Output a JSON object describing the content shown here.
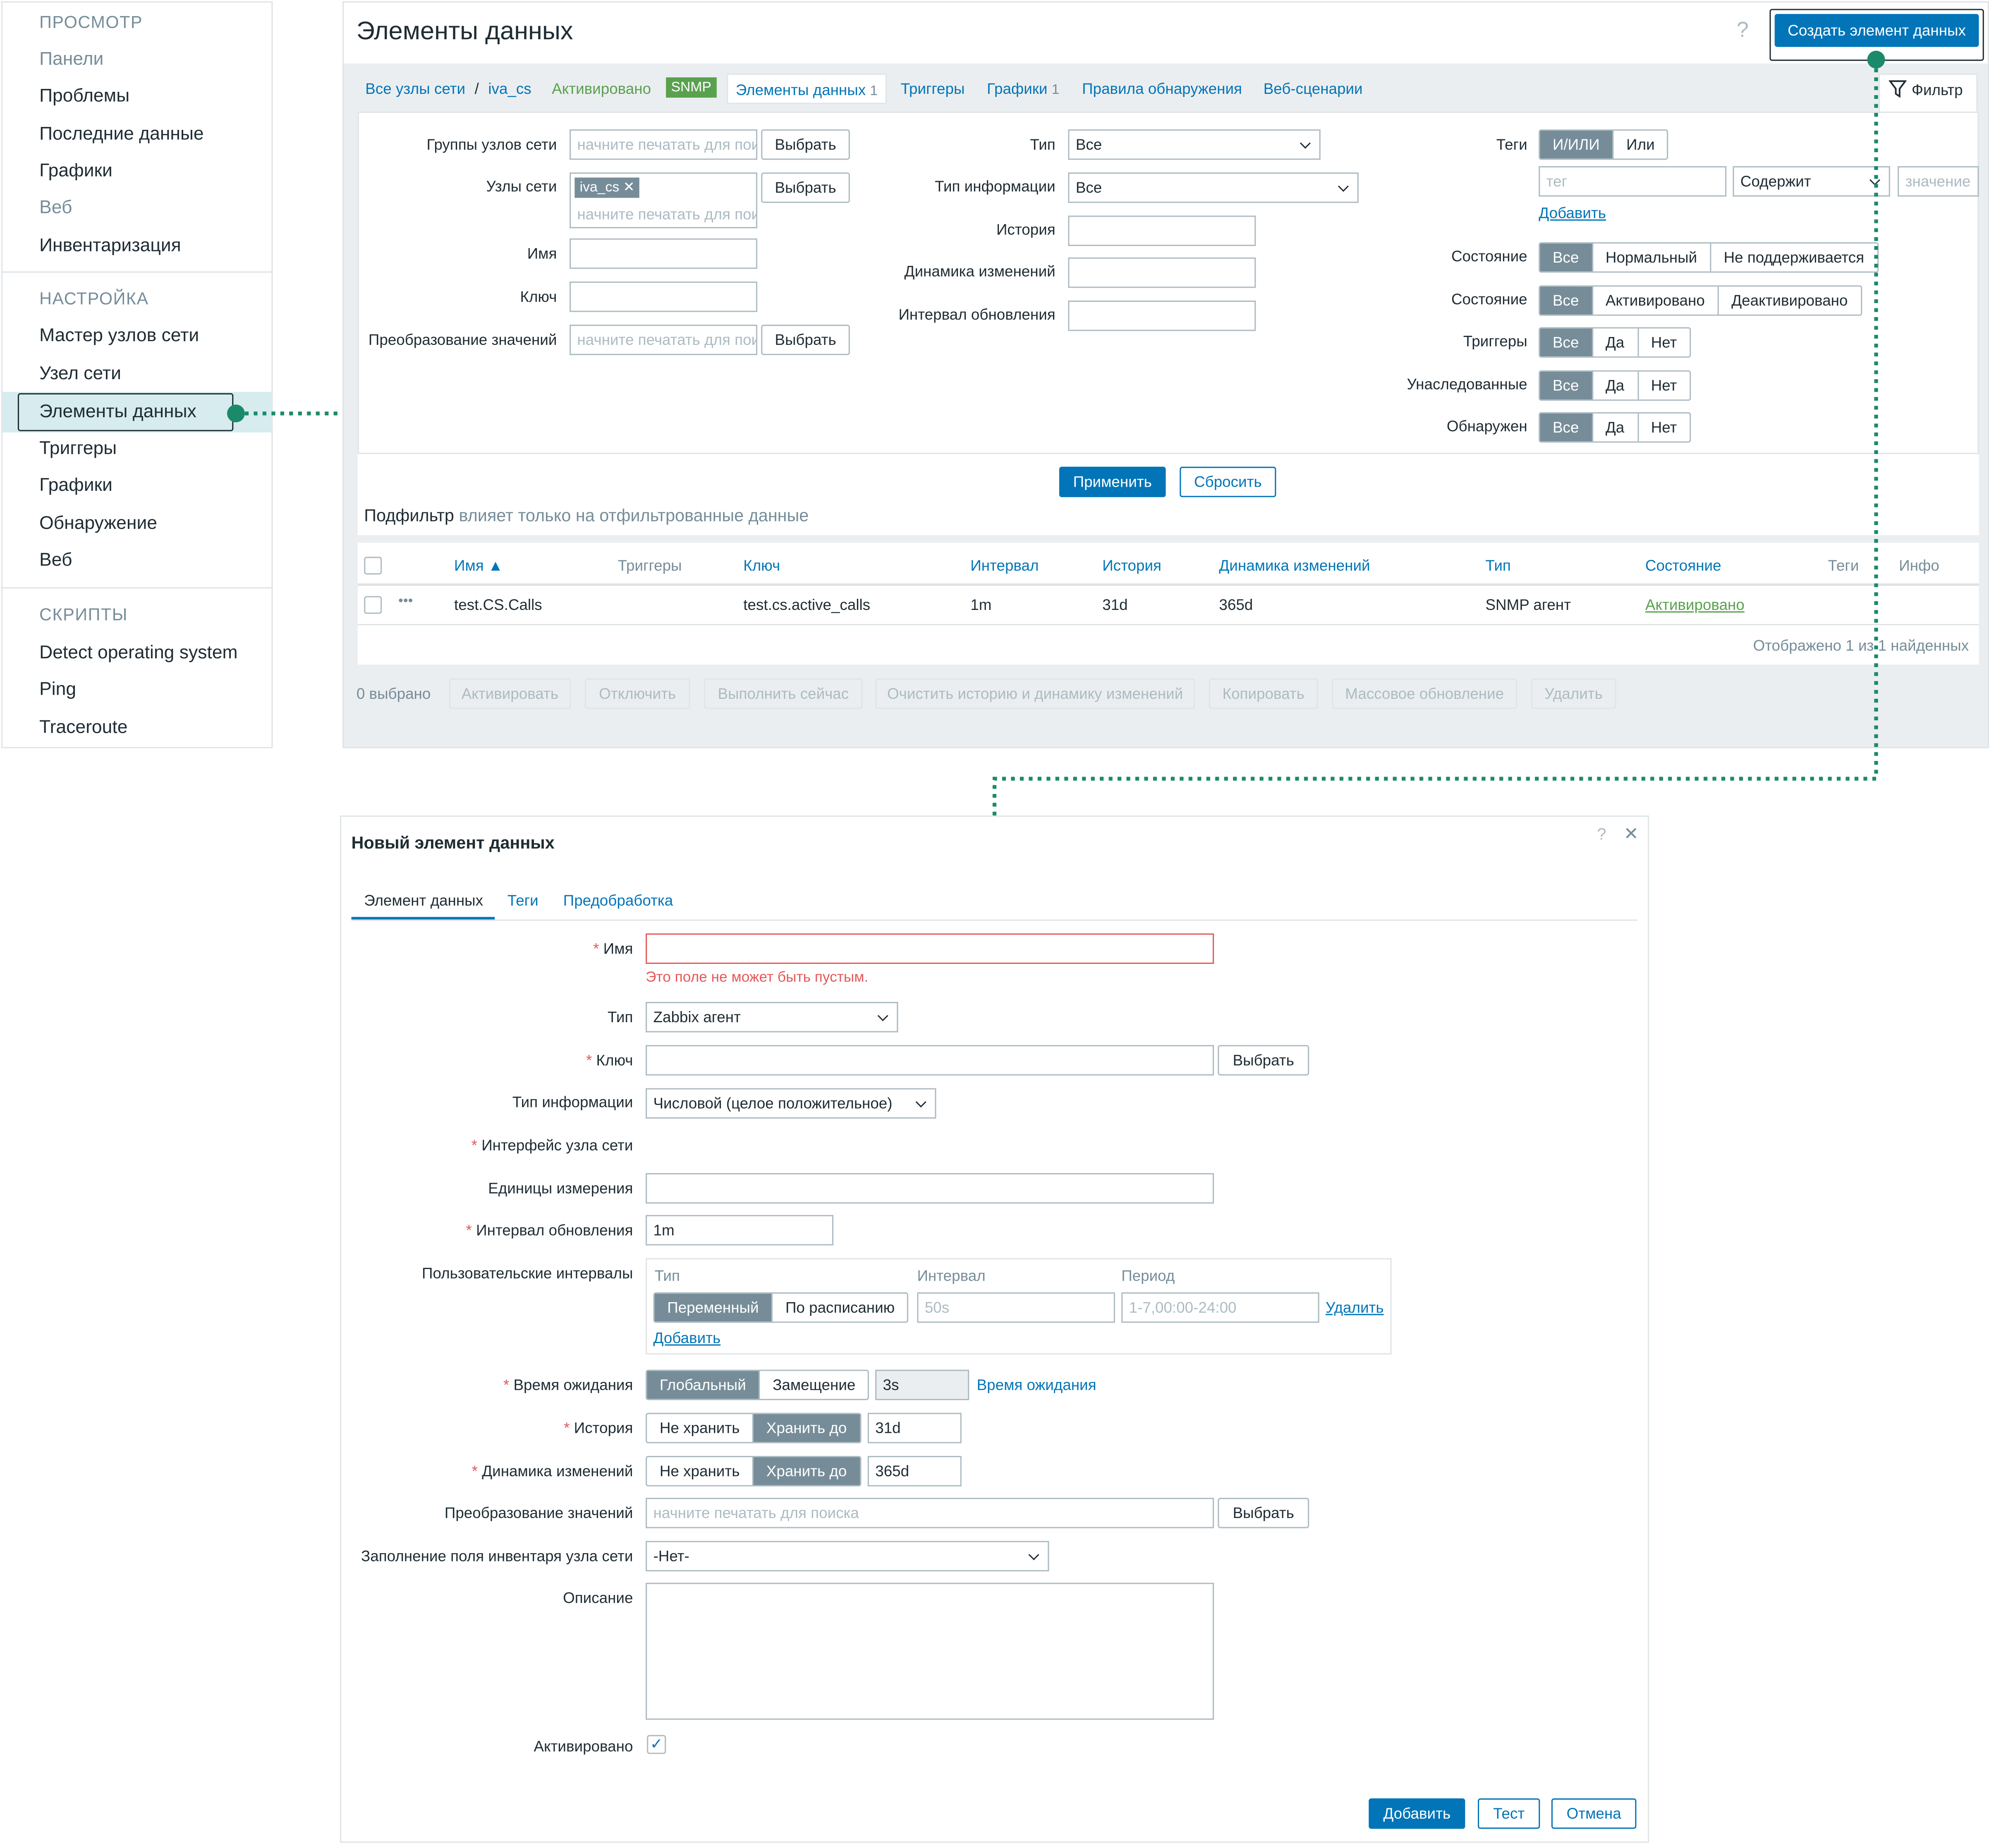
{
  "sidebar": {
    "view_header": "ПРОСМОТР",
    "view_items": [
      "Панели",
      "Проблемы",
      "Последние данные",
      "Графики",
      "Веб",
      "Инвентаризация"
    ],
    "config_header": "НАСТРОЙКА",
    "config_items": [
      "Мастер узлов сети",
      "Узел сети",
      "Элементы данных",
      "Триггеры",
      "Графики",
      "Обнаружение",
      "Веб"
    ],
    "scripts_header": "СКРИПТЫ",
    "scripts_items": [
      "Detect operating system",
      "Ping",
      "Traceroute"
    ]
  },
  "main": {
    "title": "Элементы данных",
    "help": "?",
    "create_button": "Создать элемент данных",
    "breadcrumb": {
      "all_hosts": "Все узлы сети",
      "sep": "/",
      "host": "iva_cs",
      "enabled": "Активировано",
      "snmp": "SNMP",
      "items": "Элементы данных",
      "items_count": "1",
      "triggers": "Триггеры",
      "graphs": "Графики",
      "graphs_count": "1",
      "discovery": "Правила обнаружения",
      "web": "Веб-сценарии"
    },
    "filter_tab": "Фильтр",
    "filter": {
      "host_groups_label": "Группы узлов сети",
      "host_groups_placeholder": "начните печатать для поиска",
      "hosts_label": "Узлы сети",
      "host_chip": "iva_cs",
      "hosts_placeholder": "начните печатать для поиска",
      "select": "Выбрать",
      "name_label": "Имя",
      "key_label": "Ключ",
      "valuemap_label": "Преобразование значений",
      "valuemap_placeholder": "начните печатать для поиска",
      "type_label": "Тип",
      "type_value": "Все",
      "info_type_label": "Тип информации",
      "info_type_value": "Все",
      "history_label": "История",
      "trends_label": "Динамика изменений",
      "interval_label": "Интервал обновления",
      "tags_label": "Теги",
      "tags_andor": "И/ИЛИ",
      "tags_or": "Или",
      "tag_placeholder": "тег",
      "tag_op": "Содержит",
      "value_placeholder": "значение",
      "add": "Добавить",
      "state_label": "Состояние",
      "state_opts": [
        "Все",
        "Нормальный",
        "Не поддерживается"
      ],
      "status_label": "Состояние",
      "status_opts": [
        "Все",
        "Активировано",
        "Деактивировано"
      ],
      "triggers_label": "Триггеры",
      "inherited_label": "Унаследованные",
      "discovered_label": "Обнаружен",
      "yn_opts": [
        "Все",
        "Да",
        "Нет"
      ],
      "apply": "Применить",
      "reset": "Сбросить"
    },
    "subfilter": "Подфильтр",
    "subfilter_note": "влияет только на отфильтрованные данные",
    "table": {
      "headers": [
        "Имя ▲",
        "Триггеры",
        "Ключ",
        "Интервал",
        "История",
        "Динамика изменений",
        "Тип",
        "Состояние",
        "Теги",
        "Инфо"
      ],
      "row": {
        "dots": "•••",
        "name": "test.CS.Calls",
        "key": "test.cs.active_calls",
        "interval": "1m",
        "history": "31d",
        "trends": "365d",
        "type": "SNMP агент",
        "status": "Активировано"
      },
      "footer": "Отображено 1 из 1 найденных"
    },
    "actions": {
      "selected": "0 выбрано",
      "buttons": [
        "Активировать",
        "Отключить",
        "Выполнить сейчас",
        "Очистить историю и динамику изменений",
        "Копировать",
        "Массовое обновление",
        "Удалить"
      ]
    }
  },
  "dialog": {
    "title": "Новый элемент данных",
    "help": "?",
    "close": "✕",
    "tabs": [
      "Элемент данных",
      "Теги",
      "Предобработка"
    ],
    "name_label": "Имя",
    "name_error": "Это поле не может быть пустым.",
    "type_label": "Тип",
    "type_value": "Zabbix агент",
    "key_label": "Ключ",
    "select": "Выбрать",
    "info_type_label": "Тип информации",
    "info_type_value": "Числовой (целое положительное)",
    "interface_label": "Интерфейс узла сети",
    "units_label": "Единицы измерения",
    "interval_label": "Интервал обновления",
    "interval_value": "1m",
    "custom_label": "Пользовательские интервалы",
    "custom_headers": [
      "Тип",
      "Интервал",
      "Период"
    ],
    "custom_type_opts": [
      "Переменный",
      "По расписанию"
    ],
    "custom_interval_placeholder": "50s",
    "custom_period_placeholder": "1-7,00:00-24:00",
    "remove": "Удалить",
    "add": "Добавить",
    "timeout_label": "Время ожидания",
    "timeout_opts": [
      "Глобальный",
      "Замещение"
    ],
    "timeout_value": "3s",
    "timeout_link": "Время ожидания",
    "history_label": "История",
    "keep_opts": [
      "Не хранить",
      "Хранить до"
    ],
    "history_value": "31d",
    "trends_label": "Динамика изменений",
    "trends_value": "365d",
    "valuemap_label": "Преобразование значений",
    "valuemap_placeholder": "начните печатать для поиска",
    "inventory_label": "Заполнение поля инвентаря узла сети",
    "inventory_value": "-Нет-",
    "description_label": "Описание",
    "enabled_label": "Активировано",
    "check": "✓",
    "btn_add": "Добавить",
    "btn_test": "Тест",
    "btn_cancel": "Отмена"
  },
  "colors": {
    "accent": "#0275b8",
    "callout": "#1b8a6b",
    "selected_bg": "#d6ecef",
    "snmp_badge": "#59a14f",
    "error": "#e45959"
  }
}
